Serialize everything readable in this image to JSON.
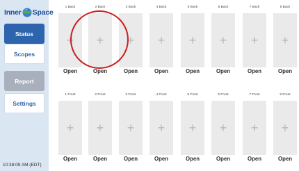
{
  "app": {
    "logo_part1": "Inner",
    "logo_part2": "Space",
    "clock": "10:38:09 AM (EDT)"
  },
  "nav": {
    "status": "Status",
    "scopes": "Scopes",
    "report": "Report",
    "settings": "Settings"
  },
  "back_slots": [
    {
      "label": "1 Back",
      "action": "Open"
    },
    {
      "label": "2 Back",
      "action": "Open"
    },
    {
      "label": "3 Back",
      "action": "Open"
    },
    {
      "label": "4 Back",
      "action": "Open"
    },
    {
      "label": "5 Back",
      "action": "Open"
    },
    {
      "label": "6 Back",
      "action": "Open"
    },
    {
      "label": "7 Back",
      "action": "Open"
    },
    {
      "label": "8 Back",
      "action": "Open"
    }
  ],
  "front_slots": [
    {
      "label": "1 Front",
      "action": "Open"
    },
    {
      "label": "2 Front",
      "action": "Open"
    },
    {
      "label": "3 Front",
      "action": "Open"
    },
    {
      "label": "4 Front",
      "action": "Open"
    },
    {
      "label": "5 Front",
      "action": "Open"
    },
    {
      "label": "6 Front",
      "action": "Open"
    },
    {
      "label": "7 Front",
      "action": "Open"
    },
    {
      "label": "8 Front",
      "action": "Open"
    }
  ],
  "slot_icon": "plus-icon",
  "colors": {
    "sidebar_bg": "#dbe6f3",
    "accent": "#2e63ad",
    "disabled": "#a9b0bb",
    "highlight_circle": "#c81e1e"
  }
}
